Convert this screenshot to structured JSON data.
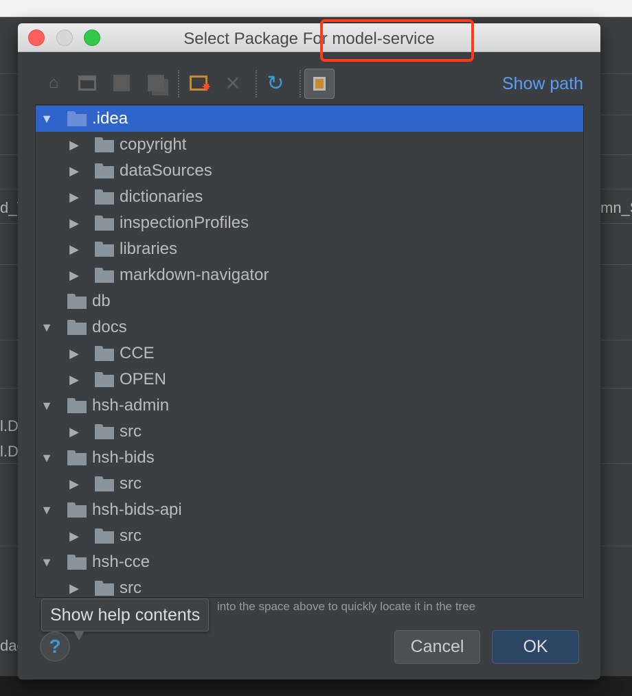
{
  "background": {
    "fragments": [
      "d_T",
      "mn_S",
      "l.D",
      "l.D",
      "dac"
    ]
  },
  "dialog": {
    "title": "Select Package For model-service",
    "toolbar": {
      "icons": [
        "home-icon",
        "desktop-icon",
        "project-folder-icon",
        "module-folder-icon",
        "new-folder-icon",
        "delete-icon",
        "refresh-icon",
        "show-hidden-icon"
      ],
      "show_path": "Show path"
    },
    "tree": [
      {
        "label": ".idea",
        "level": 0,
        "expanded": true,
        "selected": true
      },
      {
        "label": "copyright",
        "level": 1,
        "expanded": false
      },
      {
        "label": "dataSources",
        "level": 1,
        "expanded": false
      },
      {
        "label": "dictionaries",
        "level": 1,
        "expanded": false
      },
      {
        "label": "inspectionProfiles",
        "level": 1,
        "expanded": false
      },
      {
        "label": "libraries",
        "level": 1,
        "expanded": false
      },
      {
        "label": "markdown-navigator",
        "level": 1,
        "expanded": false
      },
      {
        "label": "db",
        "level": 0,
        "leaf": true
      },
      {
        "label": "docs",
        "level": 0,
        "expanded": true
      },
      {
        "label": "CCE",
        "level": 1,
        "expanded": false
      },
      {
        "label": "OPEN",
        "level": 1,
        "expanded": false
      },
      {
        "label": "hsh-admin",
        "level": 0,
        "expanded": true
      },
      {
        "label": "src",
        "level": 1,
        "expanded": false
      },
      {
        "label": "hsh-bids",
        "level": 0,
        "expanded": true
      },
      {
        "label": "src",
        "level": 1,
        "expanded": false
      },
      {
        "label": "hsh-bids-api",
        "level": 0,
        "expanded": true
      },
      {
        "label": "src",
        "level": 1,
        "expanded": false
      },
      {
        "label": "hsh-cce",
        "level": 0,
        "expanded": true
      },
      {
        "label": "src",
        "level": 1,
        "expanded": false
      }
    ],
    "hint": "into the space above to quickly locate it in the tree",
    "tooltip": "Show help contents",
    "help_icon": "?",
    "cancel_label": "Cancel",
    "ok_label": "OK"
  },
  "colors": {
    "selection": "#2f65ca",
    "link": "#589df6",
    "annotation": "#ff3b1a"
  }
}
